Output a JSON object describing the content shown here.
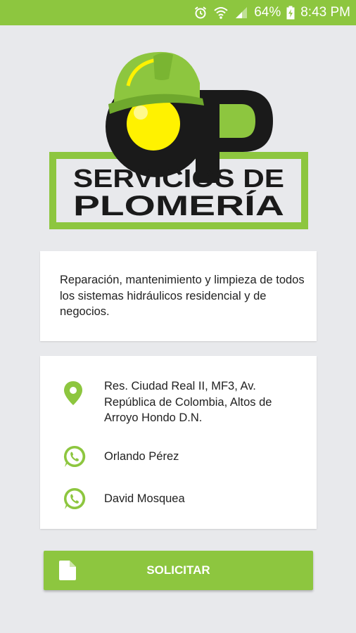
{
  "status_bar": {
    "battery": "64%",
    "time": "8:43 PM",
    "icons": [
      "alarm-icon",
      "wifi-icon",
      "signal-icon",
      "battery-charging-icon"
    ],
    "background": "#8dc63f"
  },
  "logo": {
    "line1": "SERVICIOS DE",
    "line2": "PLOMERÍA",
    "colors": {
      "green": "#8dc63f",
      "black": "#1a1a1a",
      "yellow": "#fff200"
    }
  },
  "description": "Reparación, mantenimiento y limpieza de todos los sistemas hidráulicos residencial y de negocios.",
  "contact": {
    "address": "Res. Ciudad Real II, MF3, Av. República de Colombia, Altos de Arroyo Hondo D.N.",
    "contacts": [
      {
        "name": "Orlando Pérez",
        "icon": "whatsapp-icon"
      },
      {
        "name": "David Mosquea",
        "icon": "whatsapp-icon"
      }
    ],
    "icon_color": "#8dc63f"
  },
  "actions": {
    "solicitar_label": "SOLICITAR",
    "button_color": "#8dc63f"
  }
}
